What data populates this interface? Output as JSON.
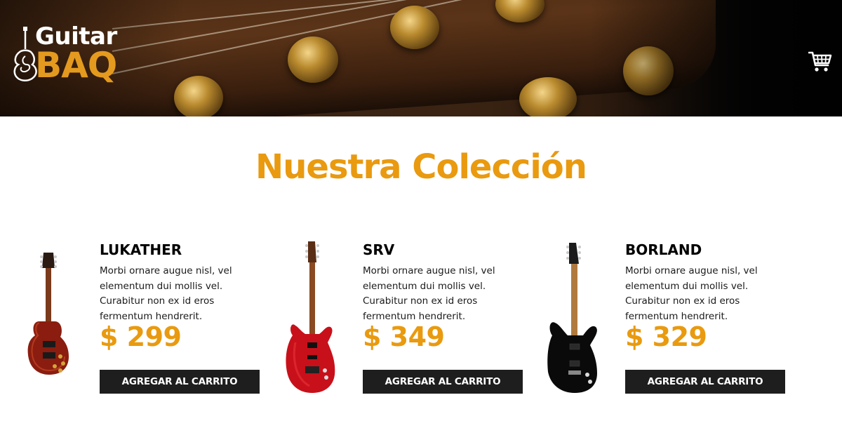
{
  "header": {
    "logo": {
      "word1": "Guitar",
      "word2": "BAQ"
    },
    "cart_icon": "shopping-cart-icon"
  },
  "section": {
    "title": "Nuestra Colección"
  },
  "colors": {
    "accent": "#e99a0f",
    "button_bg": "#1e1e1e",
    "logo_accent": "#e39a1e"
  },
  "products": [
    {
      "name": "LUKATHER",
      "description": "Morbi ornare augue nisl, vel elementum dui mollis vel. Curabitur non ex id eros fermentum hendrerit.",
      "price": "$ 299",
      "button_label": "AGREGAR AL CARRITO",
      "image_icon": "les-paul-guitar-icon"
    },
    {
      "name": "SRV",
      "description": "Morbi ornare augue nisl, vel elementum dui mollis vel. Curabitur non ex id eros fermentum hendrerit.",
      "price": "$ 349",
      "button_label": "AGREGAR AL CARRITO",
      "image_icon": "red-strat-guitar-icon"
    },
    {
      "name": "BORLAND",
      "description": "Morbi ornare augue nisl, vel elementum dui mollis vel. Curabitur non ex id eros fermentum hendrerit.",
      "price": "$ 329",
      "button_label": "AGREGAR AL CARRITO",
      "image_icon": "black-guitar-icon"
    }
  ]
}
